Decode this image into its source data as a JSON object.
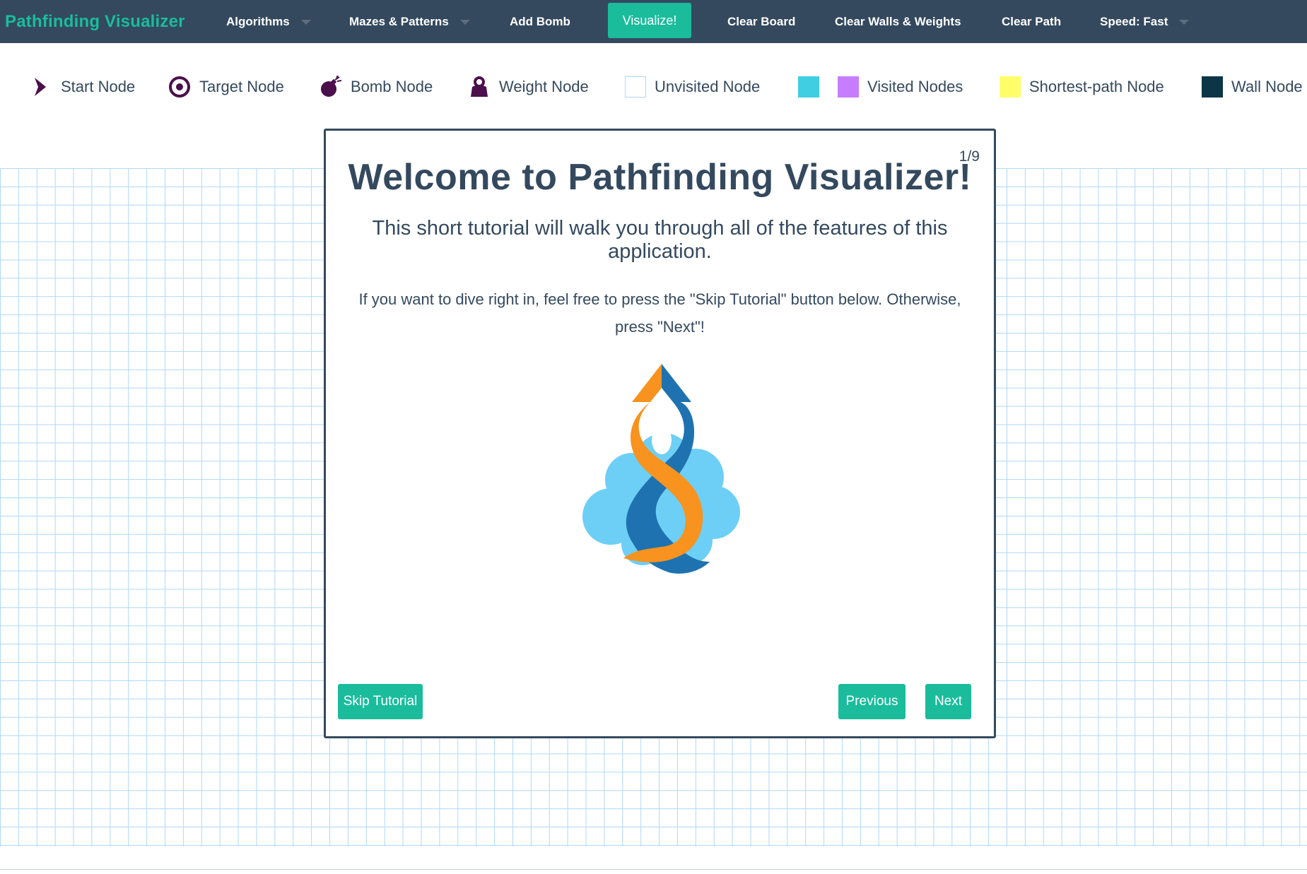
{
  "navbar": {
    "brand": "Pathfinding Visualizer",
    "algorithms": "Algorithms",
    "mazes": "Mazes & Patterns",
    "add_bomb": "Add Bomb",
    "visualize": "Visualize!",
    "clear_board": "Clear Board",
    "clear_walls": "Clear Walls & Weights",
    "clear_path": "Clear Path",
    "speed": "Speed: Fast"
  },
  "legend": {
    "start": "Start Node",
    "target": "Target Node",
    "bomb": "Bomb Node",
    "weight": "Weight Node",
    "unvisited": "Unvisited Node",
    "visited": "Visited Nodes",
    "shortest": "Shortest-path Node",
    "wall": "Wall Node"
  },
  "colors": {
    "navbar": "#34495e",
    "accent": "#1abc9c",
    "visited_a": "#40cee3",
    "visited_b": "#c77dff",
    "shortest": "#fffe6a",
    "wall": "#0c3547",
    "grid_line": "#afd8f8",
    "icon": "#4b0f4b"
  },
  "modal": {
    "counter": "1/9",
    "title": "Welcome to Pathfinding Visualizer!",
    "subtitle": "This short tutorial will walk you through all of the features of this application.",
    "body": "If you want to dive right in, feel free to press the \"Skip Tutorial\" button below. Otherwise, press \"Next\"!",
    "skip": "Skip Tutorial",
    "previous": "Previous",
    "next": "Next"
  }
}
